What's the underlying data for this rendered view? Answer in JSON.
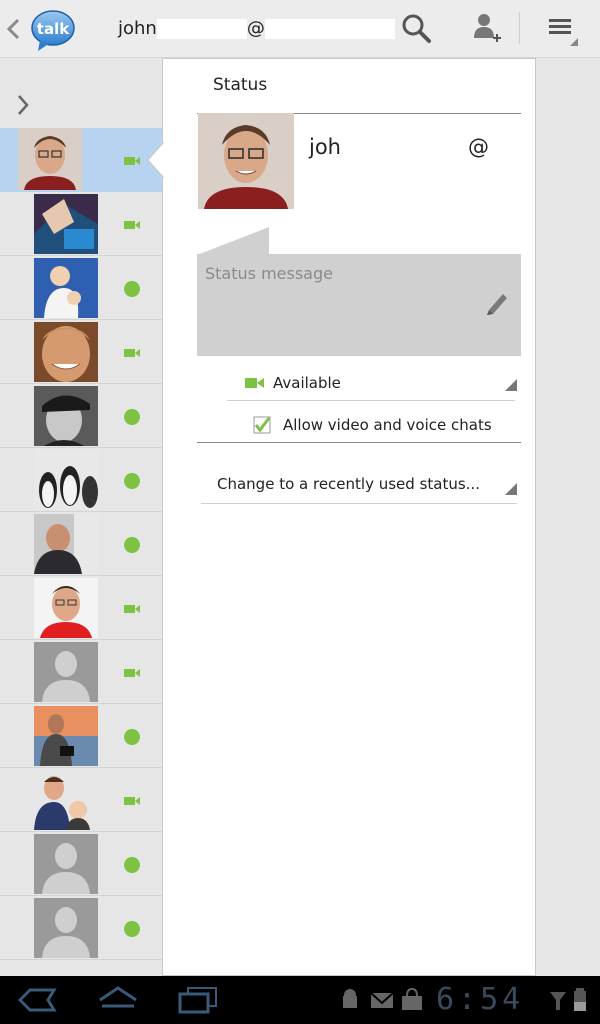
{
  "header": {
    "account_prefix": "john",
    "account_at": "@",
    "logo_text": "talk",
    "icons": [
      "back-chevron-icon",
      "search-icon",
      "add-contact-icon",
      "menu-icon"
    ]
  },
  "contacts": [
    {
      "presence": "video",
      "selected": true
    },
    {
      "presence": "video"
    },
    {
      "presence": "available"
    },
    {
      "presence": "video"
    },
    {
      "presence": "available"
    },
    {
      "presence": "available"
    },
    {
      "presence": "available"
    },
    {
      "presence": "video"
    },
    {
      "presence": "video"
    },
    {
      "presence": "available"
    },
    {
      "presence": "video"
    },
    {
      "presence": "available"
    },
    {
      "presence": "available"
    }
  ],
  "status_panel": {
    "title": "Status",
    "name": "joh",
    "name_at": "@",
    "status_placeholder": "Status message",
    "availability": "Available",
    "allow_label": "Allow video and voice chats",
    "allow_checked": true,
    "recent_status": "Change to a recently used status..."
  },
  "system_bar": {
    "time": "6:54"
  },
  "colors": {
    "presence_green": "#7dc242",
    "selected_row": "#b7d3ef",
    "status_box": "#d0d0d0"
  }
}
